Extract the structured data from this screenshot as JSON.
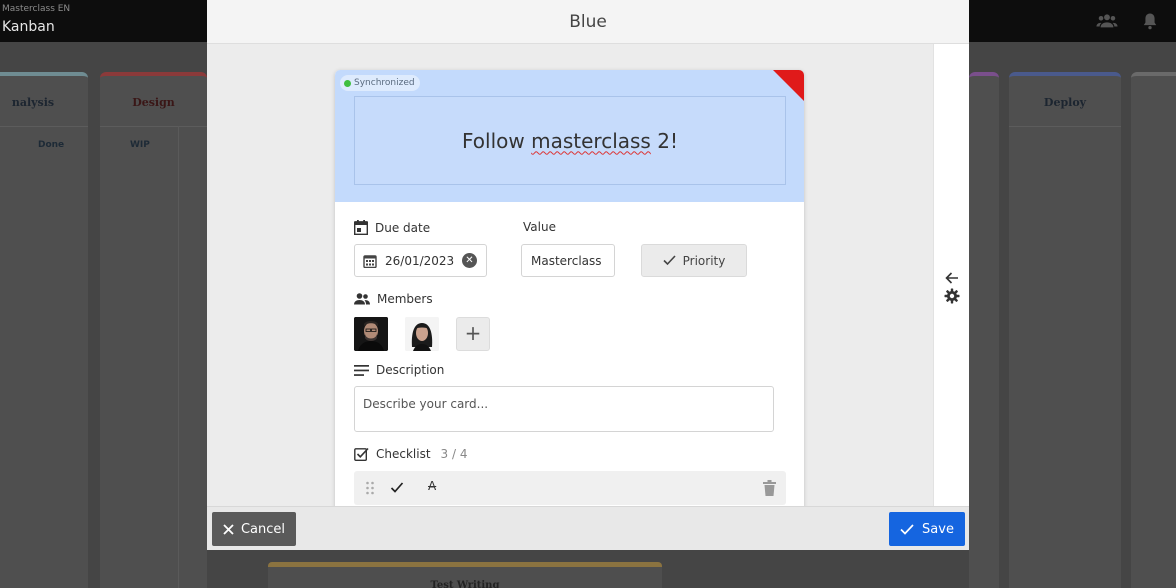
{
  "app": {
    "workspace": "Masterclass EN",
    "view_title": "Kanban"
  },
  "board": {
    "columns": [
      {
        "name": "nalysis",
        "sub": "Done"
      },
      {
        "name": "Design",
        "sub": "WIP"
      },
      {
        "name": "Deploy",
        "sub": ""
      }
    ],
    "background_card": "Test Writing"
  },
  "modal": {
    "title": "Blue",
    "cancel_label": "Cancel",
    "save_label": "Save"
  },
  "card": {
    "color": "#c3dafc",
    "sync_label": "Synchronized",
    "title_before": "Follow ",
    "title_misspelled": "masterclass",
    "title_after": " 2!",
    "due_date_label": "Due date",
    "due_date_value": "26/01/2023",
    "value_label": "Value",
    "value_value": "Masterclass",
    "priority_label": "Priority",
    "members_label": "Members",
    "description_label": "Description",
    "description_placeholder": "Describe your card...",
    "checklist_label": "Checklist",
    "checklist_count": "3 / 4",
    "checklist_item_text": "A"
  },
  "colors": {
    "accent": "#1565e0",
    "corner_flag": "#e01a1a",
    "sync_dot": "#3fbf3f"
  }
}
